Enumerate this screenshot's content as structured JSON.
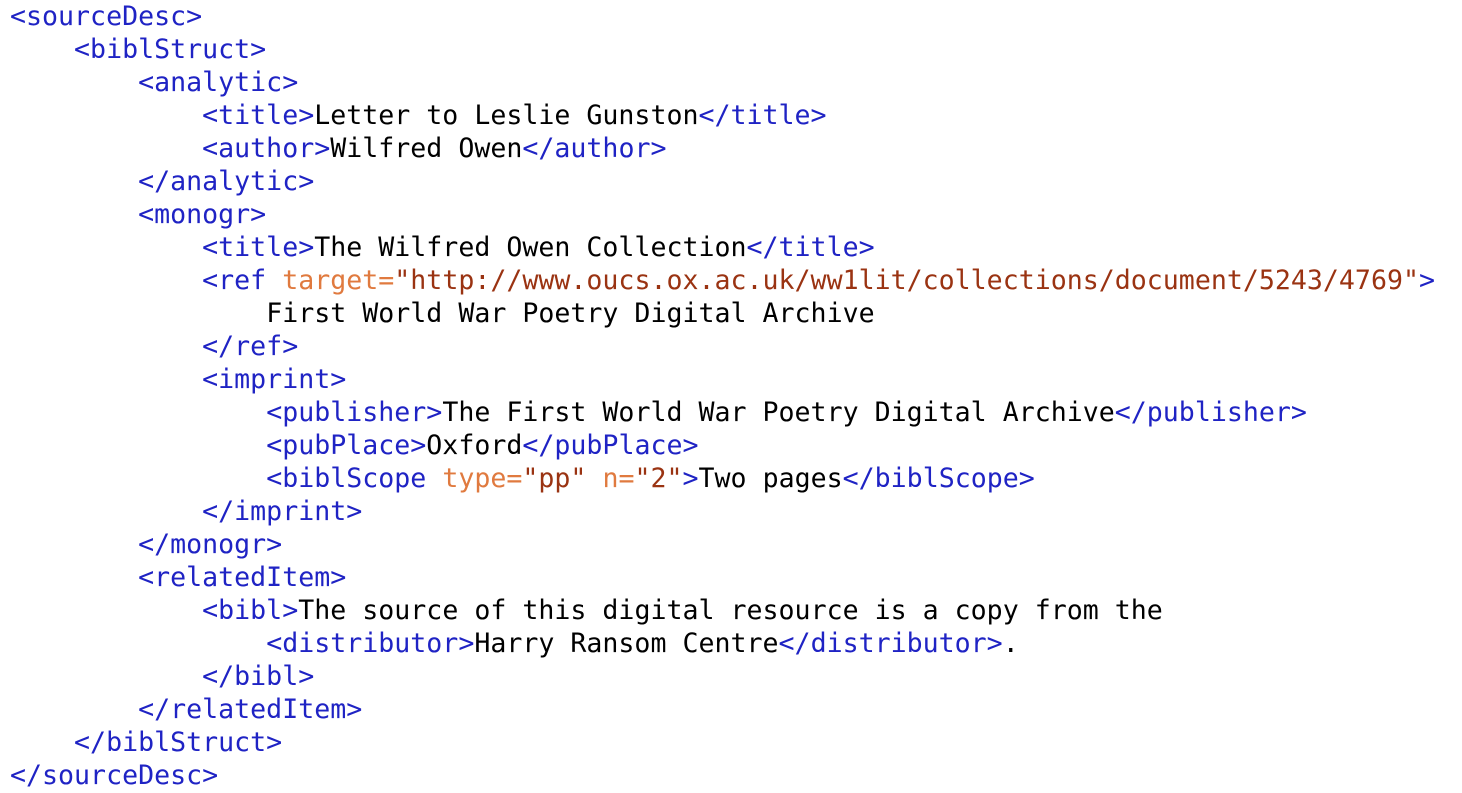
{
  "document": {
    "lines": [
      {
        "indent": 0,
        "tokens": [
          {
            "t": "tag",
            "v": "<sourceDesc>"
          }
        ]
      },
      {
        "indent": 1,
        "tokens": [
          {
            "t": "tag",
            "v": "<biblStruct>"
          }
        ]
      },
      {
        "indent": 2,
        "tokens": [
          {
            "t": "tag",
            "v": "<analytic>"
          }
        ]
      },
      {
        "indent": 3,
        "tokens": [
          {
            "t": "tag",
            "v": "<title>"
          },
          {
            "t": "txt",
            "v": "Letter to Leslie Gunston"
          },
          {
            "t": "tag",
            "v": "</title>"
          }
        ]
      },
      {
        "indent": 3,
        "tokens": [
          {
            "t": "tag",
            "v": "<author>"
          },
          {
            "t": "txt",
            "v": "Wilfred Owen"
          },
          {
            "t": "tag",
            "v": "</author>"
          }
        ]
      },
      {
        "indent": 2,
        "tokens": [
          {
            "t": "tag",
            "v": "</analytic>"
          }
        ]
      },
      {
        "indent": 2,
        "tokens": [
          {
            "t": "tag",
            "v": "<monogr>"
          }
        ]
      },
      {
        "indent": 3,
        "tokens": [
          {
            "t": "tag",
            "v": "<title>"
          },
          {
            "t": "txt",
            "v": "The Wilfred Owen Collection"
          },
          {
            "t": "tag",
            "v": "</title>"
          }
        ]
      },
      {
        "indent": 3,
        "tokens": [
          {
            "t": "tag",
            "v": "<ref "
          },
          {
            "t": "attr",
            "v": "target="
          },
          {
            "t": "val",
            "v": "\"http://www.oucs.ox.ac.uk/ww1lit/collections/document/5243/4769\""
          },
          {
            "t": "tag",
            "v": ">"
          }
        ]
      },
      {
        "indent": 4,
        "tokens": [
          {
            "t": "txt",
            "v": "First World War Poetry Digital Archive"
          }
        ]
      },
      {
        "indent": 3,
        "tokens": [
          {
            "t": "tag",
            "v": "</ref>"
          }
        ]
      },
      {
        "indent": 3,
        "tokens": [
          {
            "t": "tag",
            "v": "<imprint>"
          }
        ]
      },
      {
        "indent": 4,
        "tokens": [
          {
            "t": "tag",
            "v": "<publisher>"
          },
          {
            "t": "txt",
            "v": "The First World War Poetry Digital Archive"
          },
          {
            "t": "tag",
            "v": "</publisher>"
          }
        ]
      },
      {
        "indent": 4,
        "tokens": [
          {
            "t": "tag",
            "v": "<pubPlace>"
          },
          {
            "t": "txt",
            "v": "Oxford"
          },
          {
            "t": "tag",
            "v": "</pubPlace>"
          }
        ]
      },
      {
        "indent": 4,
        "tokens": [
          {
            "t": "tag",
            "v": "<biblScope "
          },
          {
            "t": "attr",
            "v": "type="
          },
          {
            "t": "val",
            "v": "\"pp\" "
          },
          {
            "t": "attr",
            "v": "n="
          },
          {
            "t": "val",
            "v": "\"2\""
          },
          {
            "t": "tag",
            "v": ">"
          },
          {
            "t": "txt",
            "v": "Two pages"
          },
          {
            "t": "tag",
            "v": "</biblScope>"
          }
        ]
      },
      {
        "indent": 3,
        "tokens": [
          {
            "t": "tag",
            "v": "</imprint>"
          }
        ]
      },
      {
        "indent": 2,
        "tokens": [
          {
            "t": "tag",
            "v": "</monogr>"
          }
        ]
      },
      {
        "indent": 2,
        "tokens": [
          {
            "t": "tag",
            "v": "<relatedItem>"
          }
        ]
      },
      {
        "indent": 3,
        "tokens": [
          {
            "t": "tag",
            "v": "<bibl>"
          },
          {
            "t": "txt",
            "v": "The source of this digital resource is a copy from the"
          }
        ]
      },
      {
        "indent": 4,
        "tokens": [
          {
            "t": "tag",
            "v": "<distributor>"
          },
          {
            "t": "txt",
            "v": "Harry Ransom Centre"
          },
          {
            "t": "tag",
            "v": "</distributor>"
          },
          {
            "t": "txt",
            "v": "."
          }
        ]
      },
      {
        "indent": 3,
        "tokens": [
          {
            "t": "tag",
            "v": "</bibl>"
          }
        ]
      },
      {
        "indent": 2,
        "tokens": [
          {
            "t": "tag",
            "v": "</relatedItem>"
          }
        ]
      },
      {
        "indent": 1,
        "tokens": [
          {
            "t": "tag",
            "v": "</biblStruct>"
          }
        ]
      },
      {
        "indent": 0,
        "tokens": [
          {
            "t": "tag",
            "v": "</sourceDesc>"
          }
        ]
      }
    ]
  },
  "colors": {
    "tag": "#1f23c4",
    "attribute": "#e07a3f",
    "value": "#9a3312",
    "text": "#000000",
    "background": "#ffffff"
  }
}
